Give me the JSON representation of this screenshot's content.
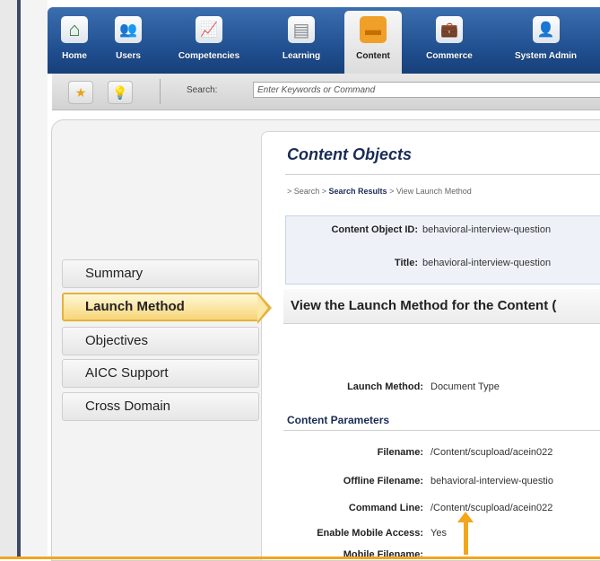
{
  "nav": {
    "items": [
      {
        "label": "Home",
        "icon": "home-icon",
        "glyph": "⌂"
      },
      {
        "label": "Users",
        "icon": "users-icon",
        "glyph": "👥"
      },
      {
        "label": "Competencies",
        "icon": "competencies-icon",
        "glyph": "📈"
      },
      {
        "label": "Learning",
        "icon": "learning-icon",
        "glyph": "▤"
      },
      {
        "label": "Content",
        "icon": "content-icon",
        "glyph": "▬"
      },
      {
        "label": "Commerce",
        "icon": "commerce-icon",
        "glyph": "💼"
      },
      {
        "label": "System Admin",
        "icon": "system-admin-icon",
        "glyph": "👤"
      }
    ],
    "active": "Content",
    "accent": "#1e4c8c"
  },
  "toolbar": {
    "favorites_icon": "star-icon",
    "tips_icon": "lightbulb-icon",
    "search_label": "Search:",
    "search_placeholder": "Enter Keywords or Command"
  },
  "sidebar": {
    "tabs": [
      "Summary",
      "Launch Method",
      "Objectives",
      "AICC Support",
      "Cross Domain"
    ],
    "active": "Launch Method",
    "active_color": "#e4b23b"
  },
  "main": {
    "title": "Content Objects",
    "breadcrumb": {
      "prefix": "> Search > ",
      "current": "Search Results",
      "suffix": " > View Launch Method"
    },
    "info": {
      "object_id_label": "Content Object ID:",
      "object_id_value": "behavioral-interview-question",
      "title_label": "Title:",
      "title_value": "behavioral-interview-question"
    },
    "section_title": "View the Launch Method for the Content (",
    "launch_method_label": "Launch Method:",
    "launch_method_value": "Document Type",
    "params_header": "Content Parameters",
    "params": [
      {
        "label": "Filename:",
        "value": "/Content/scupload/acein022"
      },
      {
        "label": "Offline Filename:",
        "value": "behavioral-interview-questio"
      },
      {
        "label": "Command Line:",
        "value": "/Content/scupload/acein022"
      },
      {
        "label": "Enable Mobile Access:",
        "value": "Yes"
      },
      {
        "label": "Mobile Filename:",
        "value": ""
      }
    ]
  },
  "annotation": {
    "arrow_color": "#f3a51c"
  }
}
